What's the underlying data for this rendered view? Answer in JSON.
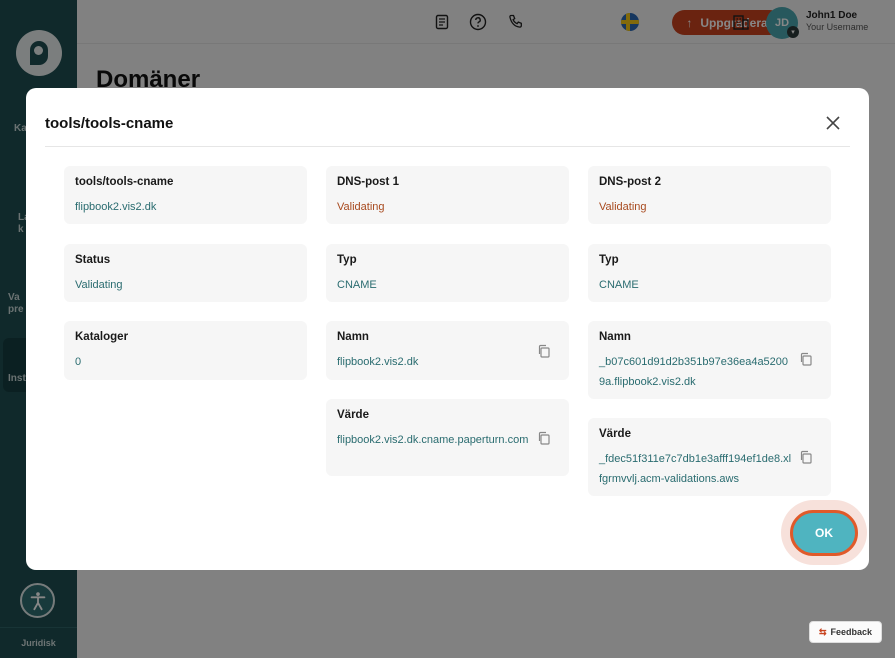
{
  "sidebar": {
    "items": [
      {
        "label": "Ka"
      },
      {
        "label": "La\nk"
      },
      {
        "label": "Va\npre"
      },
      {
        "label": "Inst"
      }
    ],
    "footer_label": "Juridisk"
  },
  "topbar": {
    "upgrade_label": "Uppgradera",
    "user_name": "John1 Doe",
    "user_sub": "Your Username",
    "avatar_initials": "JD"
  },
  "page": {
    "title": "Domäner"
  },
  "feedback_label": "Feedback",
  "modal": {
    "title": "tools/tools-cname",
    "ok_label": "OK",
    "columns": [
      {
        "cards": [
          {
            "label": "tools/tools-cname",
            "value": "flipbook2.vis2.dk"
          },
          {
            "label": "Status",
            "value": "Validating"
          },
          {
            "label": "Kataloger",
            "value": "0"
          }
        ]
      },
      {
        "cards": [
          {
            "label": "DNS-post 1",
            "value": "Validating"
          },
          {
            "label": "Typ",
            "value": "CNAME"
          },
          {
            "label": "Namn",
            "value": "flipbook2.vis2.dk"
          },
          {
            "label": "Värde",
            "value": "flipbook2.vis2.dk.cname.paperturn.com"
          }
        ]
      },
      {
        "cards": [
          {
            "label": "DNS-post 2",
            "value": "Validating"
          },
          {
            "label": "Typ",
            "value": "CNAME"
          },
          {
            "label": "Namn",
            "value": "_b07c601d91d2b351b97e36ea4a52009a.flipbook2.vis2.dk"
          },
          {
            "label": "Värde",
            "value": "_fdec51f311e7c7db1e3afff194ef1de8.xlfgrmvvlj.acm-validations.aws"
          }
        ]
      }
    ]
  },
  "colors": {
    "accent": "#4fb4c0",
    "brand_dark": "#1f4f52",
    "upgrade": "#c8431f",
    "link": "#2a6c70",
    "warning_text": "#a84a1f"
  }
}
